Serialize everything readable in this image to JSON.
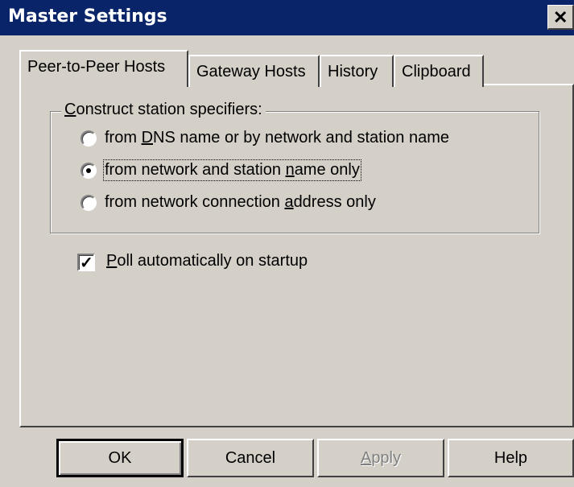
{
  "window": {
    "title": "Master Settings",
    "close_glyph": "✕"
  },
  "tabs": [
    {
      "label": "Peer-to-Peer Hosts",
      "active": true
    },
    {
      "label": "Gateway Hosts",
      "active": false
    },
    {
      "label": "History",
      "active": false
    },
    {
      "label": "Clipboard",
      "active": false
    }
  ],
  "group": {
    "legend_pre": "",
    "legend_mn": "C",
    "legend_post": "onstruct station specifiers:"
  },
  "radios": [
    {
      "pre": "from ",
      "mn": "D",
      "post": "NS name or by network and station name",
      "checked": false
    },
    {
      "pre": "from network and station ",
      "mn": "n",
      "post": "ame only",
      "checked": true
    },
    {
      "pre": "from network connection ",
      "mn": "a",
      "post": "ddress only",
      "checked": false
    }
  ],
  "poll": {
    "mn": "P",
    "post": "oll automatically on startup",
    "checked": true,
    "glyph": "✓"
  },
  "buttons": {
    "ok": "OK",
    "cancel": "Cancel",
    "apply_mn": "A",
    "apply_post": "pply",
    "help": "Help"
  },
  "colors": {
    "titlebar": "#0a246a",
    "face": "#d4d0c8"
  }
}
